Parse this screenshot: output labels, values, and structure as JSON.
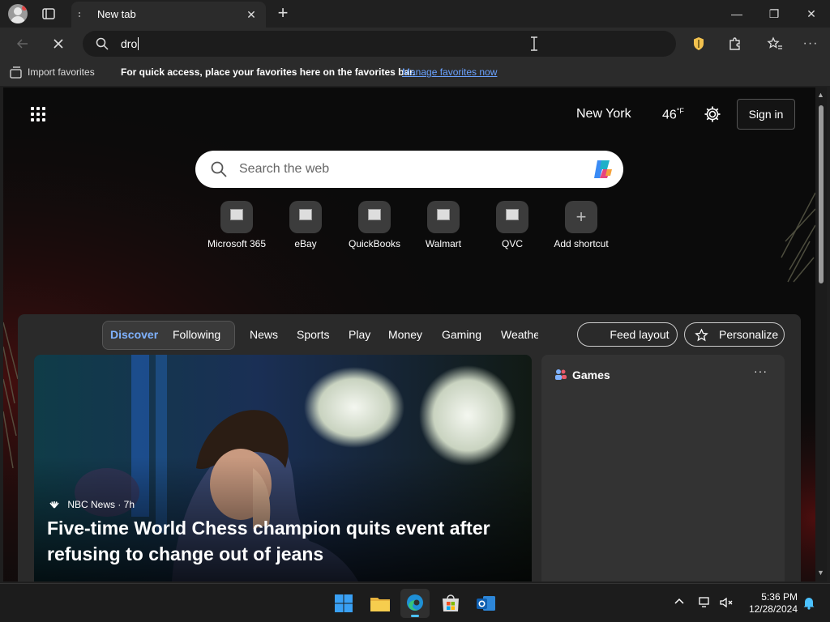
{
  "browser": {
    "tab_title": "New tab",
    "tab_close": "✕",
    "window_controls": {
      "minimize": "—",
      "maximize": "❐",
      "close": "✕"
    },
    "address_text": "dro",
    "favorites_bar": {
      "import_label": "Import favorites",
      "hint": "For quick access, place your favorites here on the favorites bar.",
      "manage_link": "Manage favorites now"
    }
  },
  "newtab": {
    "city": "New York",
    "temperature": "46",
    "temperature_unit": "°F",
    "sign_in": "Sign in",
    "search_placeholder": "Search the web",
    "shortcuts": [
      {
        "label": "Microsoft 365"
      },
      {
        "label": "eBay"
      },
      {
        "label": "QuickBooks"
      },
      {
        "label": "Walmart"
      },
      {
        "label": "QVC"
      },
      {
        "label": "Add shortcut"
      }
    ],
    "feed_nav": {
      "discover": "Discover",
      "following": "Following",
      "items": [
        "News",
        "Sports",
        "Play",
        "Money",
        "Gaming",
        "Weathe"
      ]
    },
    "feed_layout": "Feed layout",
    "personalize": "Personalize",
    "hero": {
      "source": "NBC News · 7h",
      "headline": "Five-time World Chess champion quits event after refusing to change out of jeans"
    },
    "games_card": {
      "title": "Games",
      "more": "···"
    }
  },
  "taskbar": {
    "time": "5:36 PM",
    "date": "12/28/2024"
  },
  "colors": {
    "accent": "#7fb2ff",
    "link": "#6aa2ff",
    "page_bg": "#0b0b0b",
    "feed_bg": "#2a2a2a",
    "taskbar_indicator": "#4cc2ff"
  }
}
